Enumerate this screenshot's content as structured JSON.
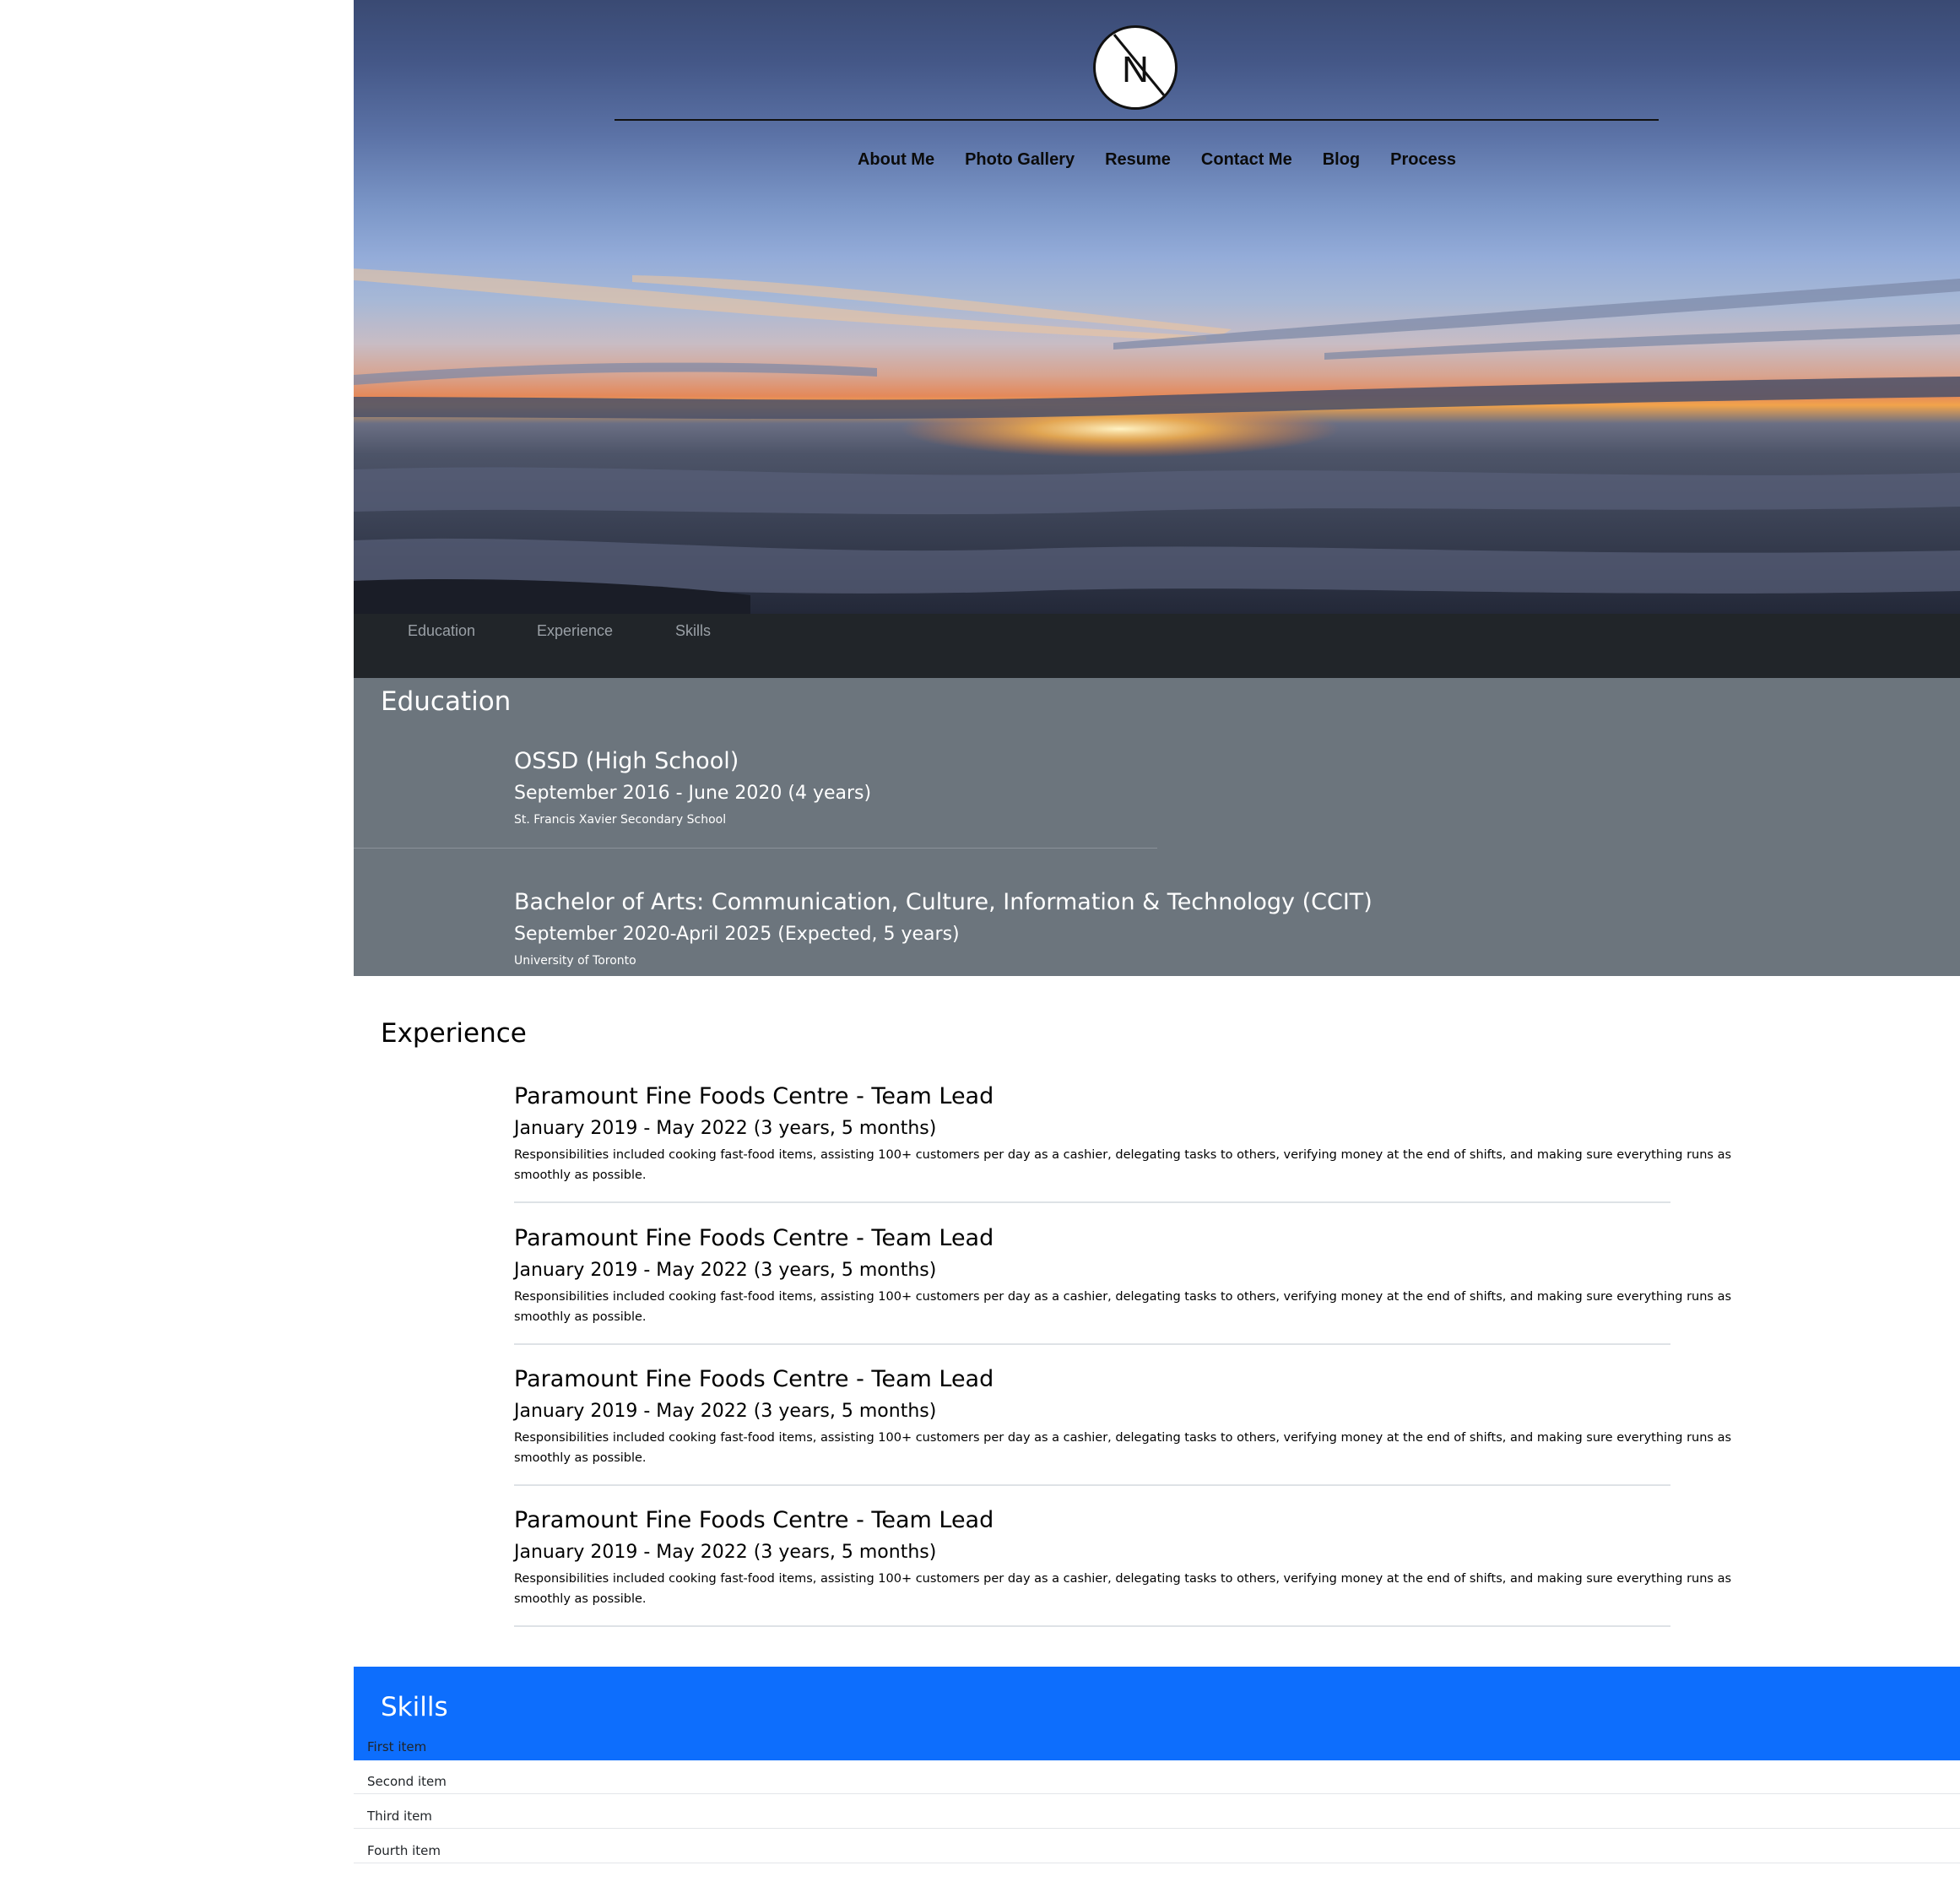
{
  "logo": {
    "letter": "N"
  },
  "main_nav": [
    "About Me",
    "Photo Gallery",
    "Resume",
    "Contact Me",
    "Blog",
    "Process"
  ],
  "sub_nav": [
    "Education",
    "Experience",
    "Skills"
  ],
  "education": {
    "title": "Education",
    "entries": [
      {
        "title": "OSSD (High School)",
        "date": "September 2016 - June 2020 (4 years)",
        "desc": "St. Francis Xavier Secondary School"
      },
      {
        "title": "Bachelor of Arts: Communication, Culture, Information & Technology (CCIT)",
        "date": "September 2020-April 2025 (Expected, 5 years)",
        "desc": "University of Toronto"
      }
    ]
  },
  "experience": {
    "title": "Experience",
    "entries": [
      {
        "title": "Paramount Fine Foods Centre - Team Lead",
        "date": "January 2019 - May 2022 (3 years, 5 months)",
        "desc": "Responsibilities included cooking fast-food items, assisting 100+ customers per day as a cashier, delegating tasks to others, verifying money at the end of shifts, and making sure everything runs as smoothly as possible."
      },
      {
        "title": "Paramount Fine Foods Centre - Team Lead",
        "date": "January 2019 - May 2022 (3 years, 5 months)",
        "desc": "Responsibilities included cooking fast-food items, assisting 100+ customers per day as a cashier, delegating tasks to others, verifying money at the end of shifts, and making sure everything runs as smoothly as possible."
      },
      {
        "title": "Paramount Fine Foods Centre - Team Lead",
        "date": "January 2019 - May 2022 (3 years, 5 months)",
        "desc": "Responsibilities included cooking fast-food items, assisting 100+ customers per day as a cashier, delegating tasks to others, verifying money at the end of shifts, and making sure everything runs as smoothly as possible."
      },
      {
        "title": "Paramount Fine Foods Centre - Team Lead",
        "date": "January 2019 - May 2022 (3 years, 5 months)",
        "desc": "Responsibilities included cooking fast-food items, assisting 100+ customers per day as a cashier, delegating tasks to others, verifying money at the end of shifts, and making sure everything runs as smoothly as possible."
      }
    ]
  },
  "skills": {
    "title": "Skills",
    "items": [
      "First item",
      "Second item",
      "Third item",
      "Fourth item"
    ]
  },
  "colors": {
    "subnav_bg": "#212529",
    "education_bg": "#6c757d",
    "skills_bg": "#0d6efd"
  }
}
